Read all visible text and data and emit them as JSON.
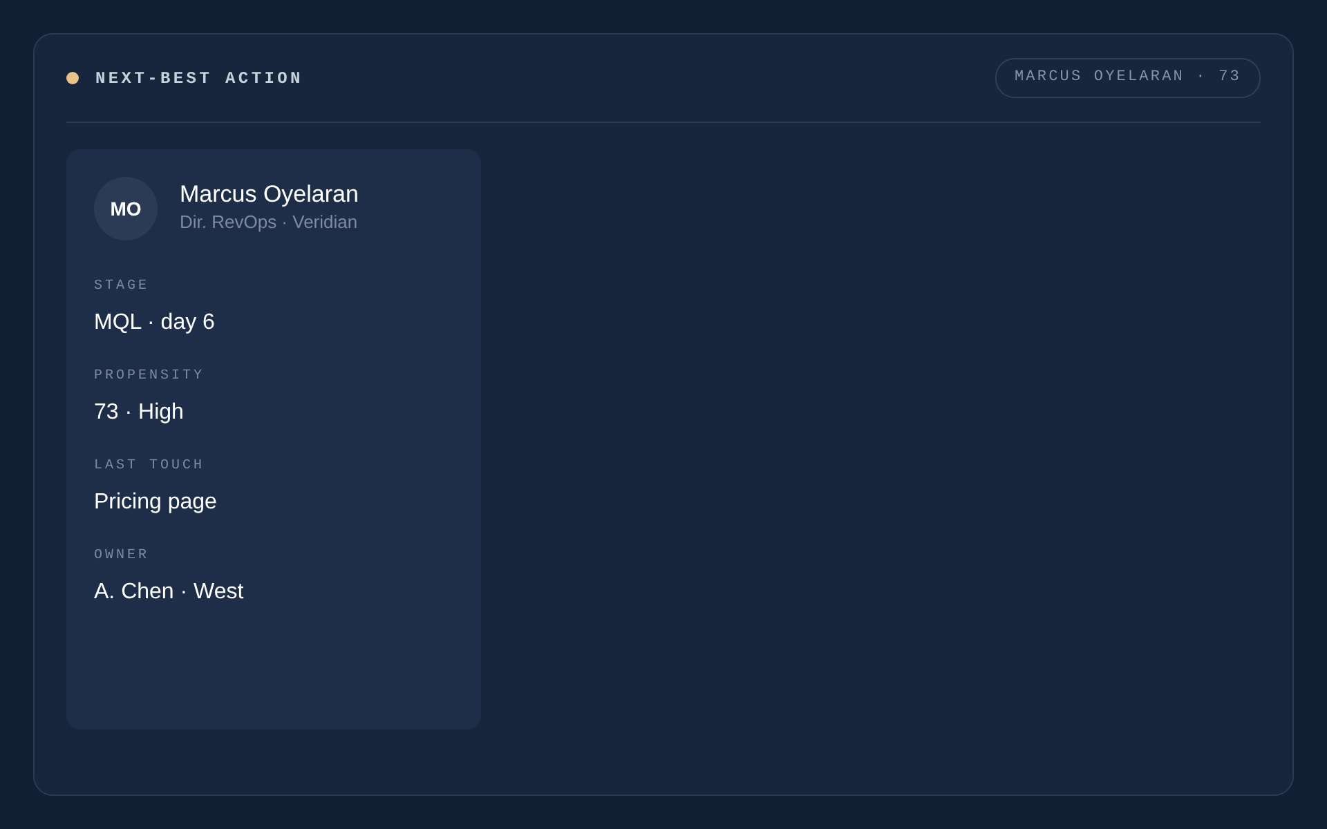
{
  "header": {
    "title": "NEXT-BEST ACTION",
    "badge": "MARCUS OYELARAN · 73"
  },
  "contact": {
    "initials": "MO",
    "name": "Marcus Oyelaran",
    "subtitle": "Dir. RevOps · Veridian",
    "fields": [
      {
        "label": "STAGE",
        "value": "MQL · day 6"
      },
      {
        "label": "PROPENSITY",
        "value": "73 · High"
      },
      {
        "label": "LAST TOUCH",
        "value": "Pricing page"
      },
      {
        "label": "OWNER",
        "value": "A. Chen · West"
      }
    ]
  }
}
